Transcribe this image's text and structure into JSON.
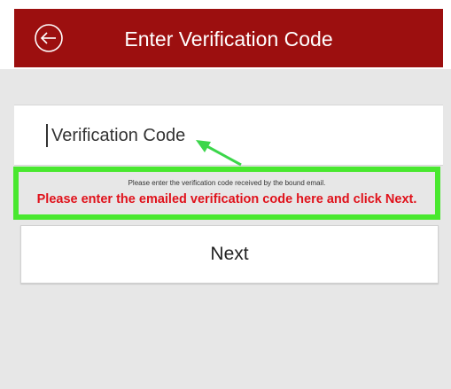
{
  "app_bar": {
    "title": "Enter Verification Code",
    "back_icon": "back-arrow-circle-icon",
    "color": "#9c0f0f"
  },
  "verification": {
    "placeholder": "Verification Code",
    "value": ""
  },
  "hint": {
    "instruction": "Please enter the verification code received by the bound email.",
    "annotation": "Please enter the emailed verification code here and click Next.",
    "annotation_color": "#e0121b",
    "highlight_color": "#49e82f"
  },
  "actions": {
    "next_label": "Next"
  }
}
